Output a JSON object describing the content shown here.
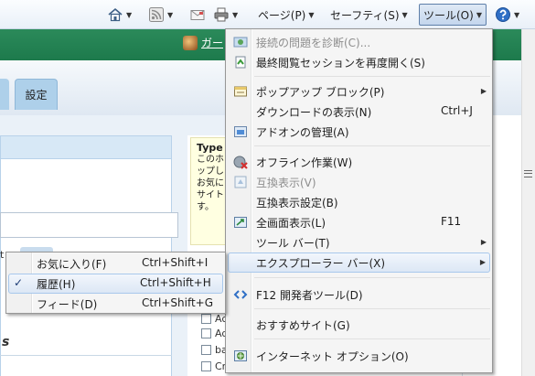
{
  "toolbar": {
    "page_menu": "ページ(P)",
    "safety_menu": "セーフティ(S)",
    "tools_menu": "ツール(O)"
  },
  "page": {
    "user_name": "ガー",
    "tab_settings": "設定",
    "yellow_box": {
      "title": "Type",
      "lines": [
        "このホ",
        "ップし",
        "お気に",
        "サイト",
        "す。"
      ]
    },
    "checkbox_items": [
      "Ac",
      "Ad",
      "ba",
      "Cr"
    ],
    "left_fragment": "t",
    "left_heading_fragment": "s"
  },
  "tools_menu": {
    "items": [
      {
        "label": "接続の問題を診断(C)...",
        "disabled": true,
        "icon": "diagnose-icon"
      },
      {
        "label": "最終閲覧セッションを再度開く(S)",
        "icon": "reopen-session-icon"
      },
      {
        "label": "ポップアップ ブロック(P)",
        "submenu": true,
        "icon": "popup-blocker-icon"
      },
      {
        "label": "ダウンロードの表示(N)",
        "shortcut": "Ctrl+J"
      },
      {
        "label": "アドオンの管理(A)",
        "icon": "addons-icon"
      },
      {
        "label": "オフライン作業(W)",
        "icon": "offline-icon"
      },
      {
        "label": "互換表示(V)",
        "disabled": true,
        "icon": "compat-view-icon"
      },
      {
        "label": "互換表示設定(B)"
      },
      {
        "label": "全画面表示(L)",
        "shortcut": "F11",
        "icon": "fullscreen-icon"
      },
      {
        "label": "ツール バー(T)",
        "submenu": true
      },
      {
        "label": "エクスプローラー バー(X)",
        "submenu": true,
        "highlighted": true
      },
      {
        "label": "F12 開発者ツール(D)",
        "icon": "developer-tools-icon"
      },
      {
        "label": "おすすめサイト(G)"
      },
      {
        "label": "インターネット オプション(O)",
        "icon": "internet-options-icon"
      }
    ]
  },
  "explorer_bar_menu": {
    "items": [
      {
        "label": "お気に入り(F)",
        "shortcut": "Ctrl+Shift+I"
      },
      {
        "label": "履歴(H)",
        "shortcut": "Ctrl+Shift+H",
        "checked": true,
        "highlighted": true
      },
      {
        "label": "フィード(D)",
        "shortcut": "Ctrl+Shift+G"
      }
    ],
    "check_mark": "✓"
  },
  "colors": {
    "band_green": "#1d7a4c",
    "menu_bg": "#f5f5f5",
    "highlight_border": "#a8c8ec",
    "disabled_text": "#8d8d8d"
  }
}
